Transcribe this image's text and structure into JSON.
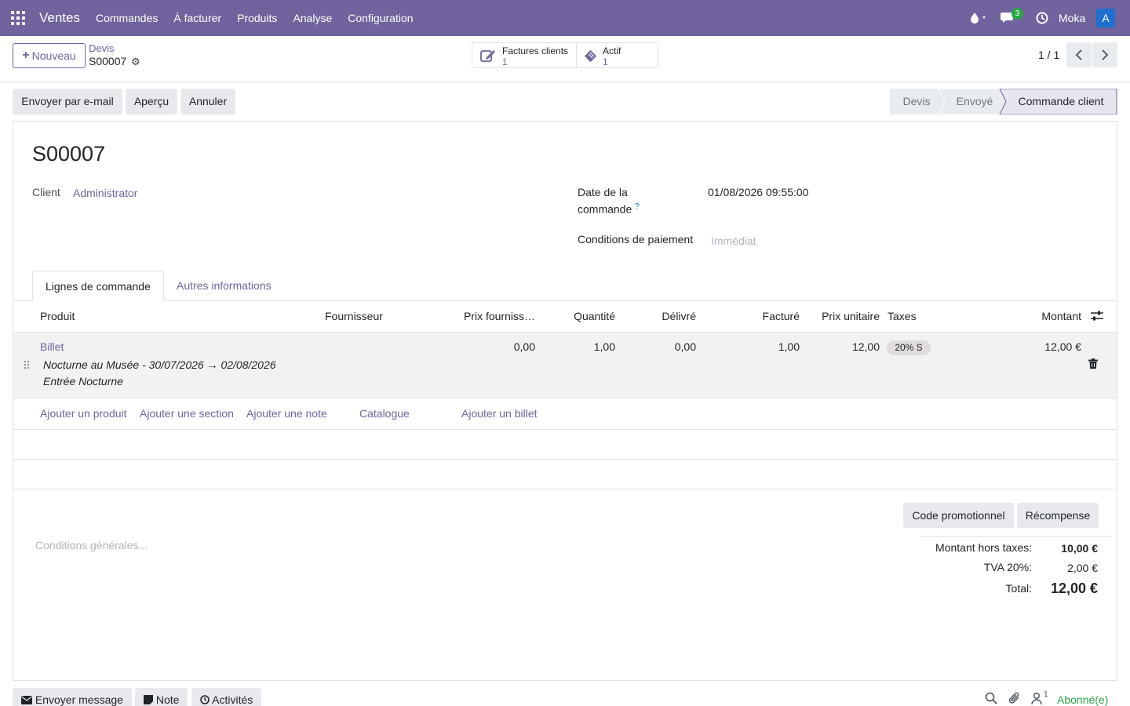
{
  "navbar": {
    "brand": "Ventes",
    "menu": [
      "Commandes",
      "À facturer",
      "Produits",
      "Analyse",
      "Configuration"
    ],
    "messages_count": "3",
    "user_name": "Moka",
    "avatar_letter": "A"
  },
  "control_panel": {
    "new_label": "Nouveau",
    "breadcrumb_parent": "Devis",
    "breadcrumb_current": "S00007",
    "smart_buttons": [
      {
        "label": "Factures clients",
        "value": "1"
      },
      {
        "label": "Actif",
        "value": "1"
      }
    ],
    "pager": "1 / 1"
  },
  "actions": {
    "send_email": "Envoyer par e-mail",
    "preview": "Aperçu",
    "cancel": "Annuler"
  },
  "statusbar": [
    "Devis",
    "Envoyé",
    "Commande client"
  ],
  "statusbar_active": "Commande client",
  "form": {
    "title": "S00007",
    "client_label": "Client",
    "client_value": "Administrator",
    "order_date_label_1": "Date de la",
    "order_date_label_2": "commande",
    "order_date_help": "?",
    "order_date_value": "01/08/2026 09:55:00",
    "payment_terms_label": "Conditions de paiement",
    "payment_terms_placeholder": "Immédiat"
  },
  "tabs": [
    "Lignes de commande",
    "Autres informations"
  ],
  "table": {
    "headers": {
      "product": "Produit",
      "supplier": "Fournisseur",
      "supplier_price": "Prix fourniss…",
      "quantity": "Quantité",
      "delivered": "Délivré",
      "invoiced": "Facturé",
      "unit_price": "Prix unitaire",
      "taxes": "Taxes",
      "amount": "Montant"
    },
    "rows": [
      {
        "product": "Billet",
        "description_1": "Nocturne au Musée - 30/07/2026 → 02/08/2026",
        "description_2": "Entrée Nocturne",
        "supplier_price": "0,00",
        "quantity": "1,00",
        "delivered": "0,00",
        "invoiced": "1,00",
        "unit_price": "12,00",
        "tax": "20% S",
        "amount": "12,00 €"
      }
    ],
    "add_links": [
      "Ajouter un produit",
      "Ajouter une section",
      "Ajouter une note",
      "Catalogue",
      "Ajouter un billet"
    ]
  },
  "footer": {
    "promo_code": "Code promotionnel",
    "reward": "Récompense",
    "terms_placeholder": "Conditions générales...",
    "untaxed_label": "Montant hors taxes:",
    "untaxed_value": "10,00 €",
    "vat_label": "TVA 20%:",
    "vat_value": "2,00 €",
    "total_label": "Total:",
    "total_value": "12,00 €"
  },
  "chatter": {
    "send_message": "Envoyer message",
    "note": "Note",
    "activities": "Activités",
    "followers_count": "1",
    "follow_status": "Abonné(e)"
  },
  "icons": {
    "apps": "apps-grid-icon",
    "debug": "droplet-icon",
    "messages": "chat-icon",
    "activity": "clock-icon",
    "gear": "gear-icon",
    "invoice": "edit-icon",
    "asset": "ticket-icon",
    "trash": "trash-icon",
    "optional_columns": "sliders-icon"
  },
  "colors": {
    "brand": "#71639e",
    "success": "#28a745"
  }
}
